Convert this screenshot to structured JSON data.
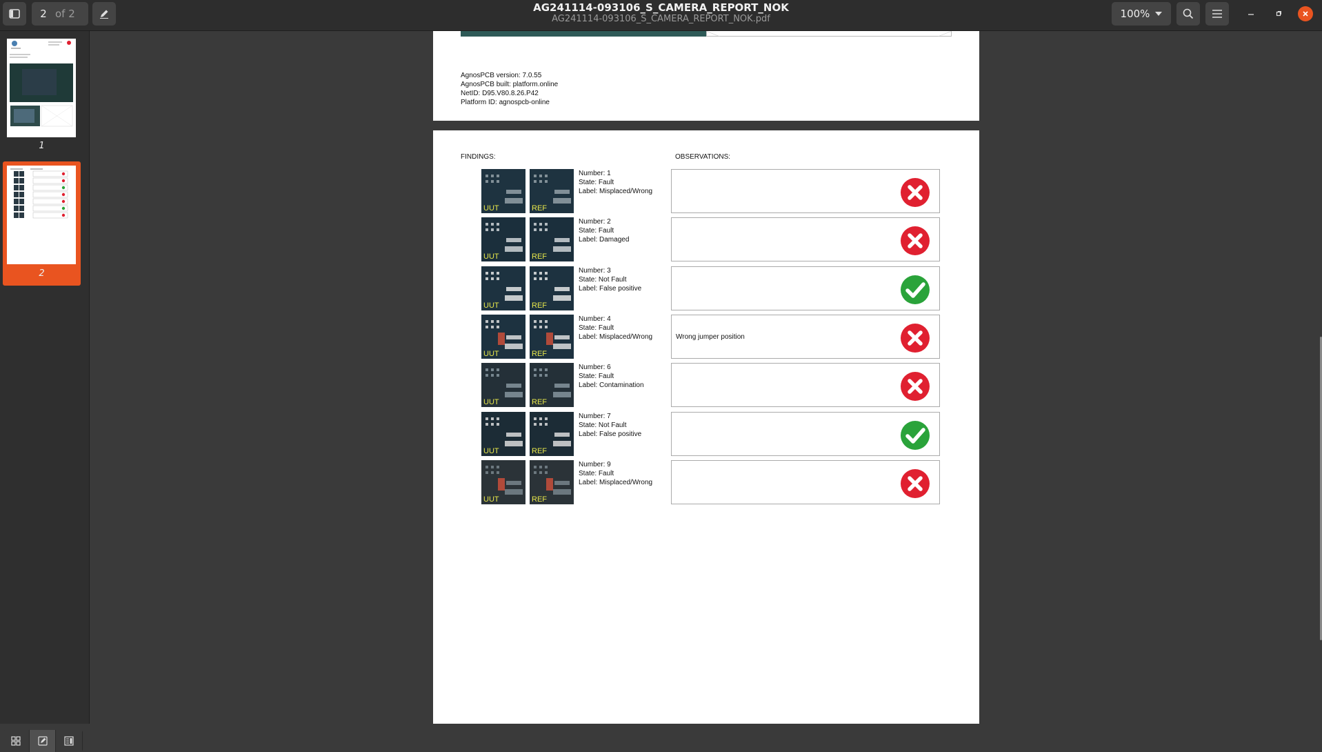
{
  "header": {
    "page_current": "2",
    "page_total": "of 2",
    "title": "AG241114-093106_S_CAMERA_REPORT_NOK",
    "subtitle": "AG241114-093106_S_CAMERA_REPORT_NOK.pdf",
    "zoom": "100%",
    "icons": {
      "sidebar_toggle": "sidebar-toggle-icon",
      "annotate": "pen-icon",
      "search": "search-icon",
      "menu": "hamburger-menu-icon",
      "minimize": "minimize-icon",
      "restore": "restore-icon",
      "close": "close-icon"
    }
  },
  "sidebar": {
    "thumbnails": [
      {
        "label": "1",
        "selected": false
      },
      {
        "label": "2",
        "selected": true
      }
    ],
    "bottom_buttons": [
      "thumbnails-view-icon",
      "annotations-view-icon",
      "outline-view-icon"
    ]
  },
  "page1": {
    "lines": [
      "AgnosPCB version: 7.0.55",
      "AgnosPCB built: platform.online",
      "NetID: D95.V80.8.26.P42",
      "Platform ID: agnospcb-online"
    ]
  },
  "page2": {
    "findings_header": "FINDINGS:",
    "observations_header": "OBSERVATIONS:",
    "uut_label": "UUT",
    "ref_label": "REF",
    "findings": [
      {
        "number": "Number: 1",
        "state": "State: Fault",
        "label": "Label: Misplaced/Wrong",
        "observation": "",
        "status": "fault"
      },
      {
        "number": "Number: 2",
        "state": "State: Fault",
        "label": "Label: Damaged",
        "observation": "",
        "status": "fault"
      },
      {
        "number": "Number: 3",
        "state": "State: Not Fault",
        "label": "Label: False positive",
        "observation": "",
        "status": "ok"
      },
      {
        "number": "Number: 4",
        "state": "State: Fault",
        "label": "Label: Misplaced/Wrong",
        "observation": "Wrong jumper position",
        "status": "fault"
      },
      {
        "number": "Number: 6",
        "state": "State: Fault",
        "label": "Label: Contamination",
        "observation": "",
        "status": "fault"
      },
      {
        "number": "Number: 7",
        "state": "State: Not Fault",
        "label": "Label: False positive",
        "observation": "",
        "status": "ok"
      },
      {
        "number": "Number: 9",
        "state": "State: Fault",
        "label": "Label: Misplaced/Wrong",
        "observation": "",
        "status": "fault"
      }
    ]
  },
  "colors": {
    "accent": "#e95420",
    "fault": "#e02030",
    "ok": "#2aa33a"
  }
}
